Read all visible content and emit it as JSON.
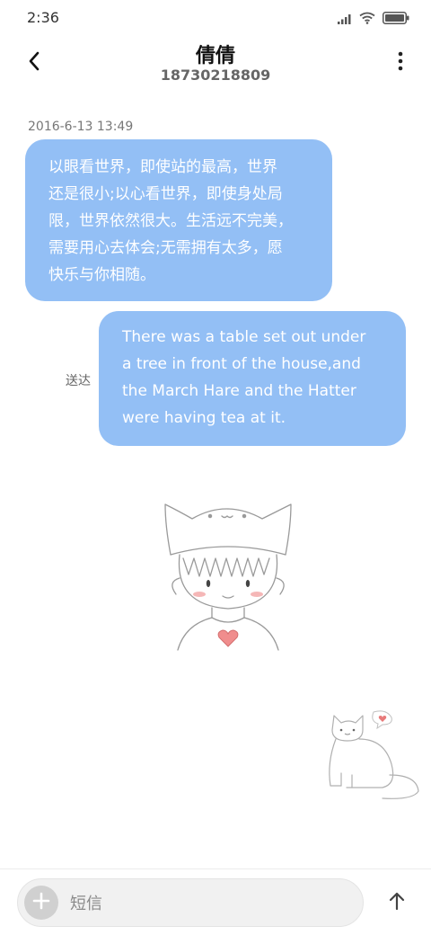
{
  "status_bar": {
    "time": "2:36",
    "icons": [
      "signal-icon",
      "wifi-icon",
      "battery-icon"
    ]
  },
  "header": {
    "contact_name": "倩倩",
    "contact_phone": "18730218809",
    "back_icon": "chevron-left-icon",
    "more_icon": "more-vertical-icon"
  },
  "conversation": {
    "timestamp": "2016-6-13 13:49",
    "messages": [
      {
        "direction": "incoming",
        "lines": [
          "以眼看世界，即使站的最高，世界",
          "还是很小;以心看世界，即使身处局",
          "限，世界依然很大。生活远不完美，",
          "需要用心去体会;无需拥有太多，愿",
          "快乐与你相随。"
        ]
      },
      {
        "direction": "outgoing",
        "status": "送达",
        "lines": [
          "There was a table set out under",
          "a tree in front of the house,and",
          "the March Hare and the Hatter",
          "were having tea at it."
        ]
      }
    ]
  },
  "composer": {
    "placeholder": "短信",
    "add_icon": "plus-icon",
    "send_icon": "arrow-up-icon"
  },
  "colors": {
    "bubble": "#93bff5",
    "bubble_text": "#ffffff",
    "background": "#ffffff"
  }
}
